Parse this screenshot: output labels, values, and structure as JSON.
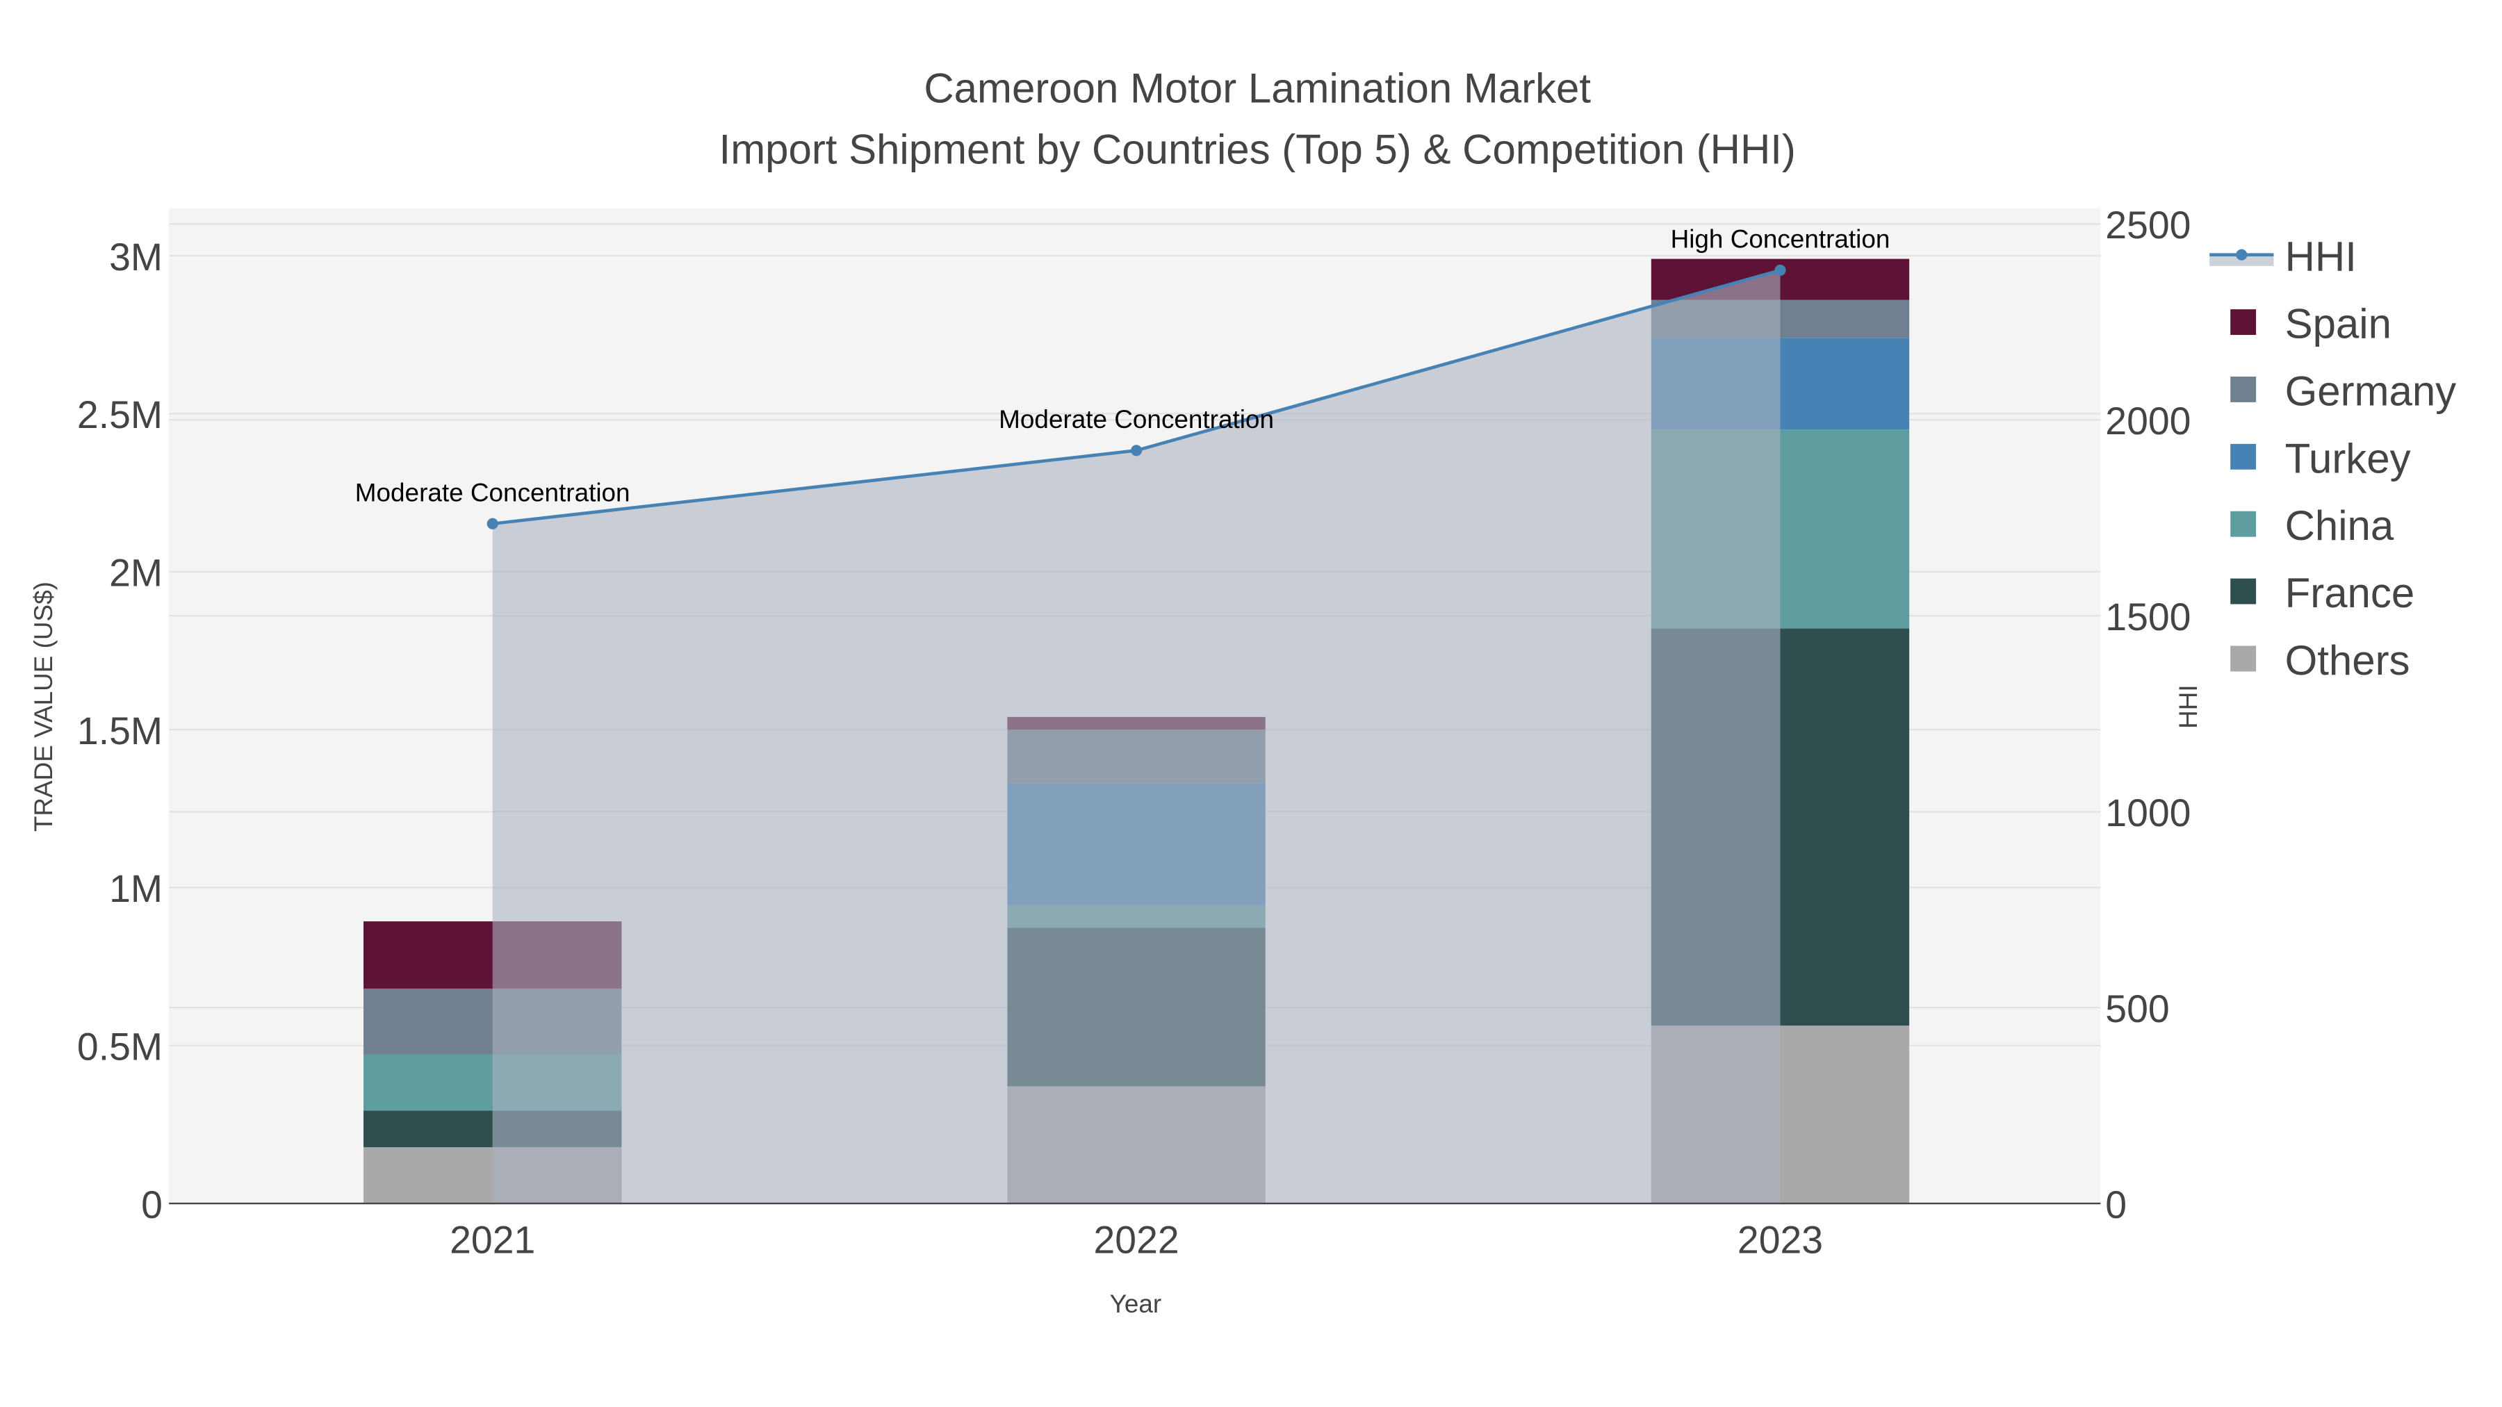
{
  "chart_data": {
    "type": "bar",
    "title": "Cameroon Motor Lamination Market",
    "subtitle": "Import Shipment by Countries (Top 5) & Competition (HHI)",
    "xlabel": "Year",
    "ylabel": "TRADE VALUE (US$)",
    "y2label": "HHI",
    "categories": [
      "2021",
      "2022",
      "2023"
    ],
    "ylim": [
      0,
      3150000
    ],
    "y2lim": [
      0,
      2540
    ],
    "yticks": [
      {
        "v": 0,
        "label": "0"
      },
      {
        "v": 500000,
        "label": "0.5M"
      },
      {
        "v": 1000000,
        "label": "1M"
      },
      {
        "v": 1500000,
        "label": "1.5M"
      },
      {
        "v": 2000000,
        "label": "2M"
      },
      {
        "v": 2500000,
        "label": "2.5M"
      },
      {
        "v": 3000000,
        "label": "3M"
      }
    ],
    "y2ticks": [
      {
        "v": 0,
        "label": "0"
      },
      {
        "v": 500,
        "label": "500"
      },
      {
        "v": 1000,
        "label": "1000"
      },
      {
        "v": 1500,
        "label": "1500"
      },
      {
        "v": 2000,
        "label": "2000"
      },
      {
        "v": 2500,
        "label": "2500"
      }
    ],
    "stacked": true,
    "series": [
      {
        "name": "Others",
        "color": "#a9a9a9",
        "values": [
          178000,
          371000,
          563000
        ]
      },
      {
        "name": "France",
        "color": "#2f4f4f",
        "values": [
          116000,
          502000,
          1257000
        ]
      },
      {
        "name": "China",
        "color": "#5f9ea0",
        "values": [
          178000,
          71000,
          630000
        ]
      },
      {
        "name": "Turkey",
        "color": "#4682b4",
        "values": [
          0,
          386000,
          290000
        ]
      },
      {
        "name": "Germany",
        "color": "#708090",
        "values": [
          208000,
          170000,
          120000
        ]
      },
      {
        "name": "Spain",
        "color": "#5e1235",
        "values": [
          213000,
          40000,
          130000
        ]
      }
    ],
    "hhi": {
      "name": "HHI",
      "color": "#4682b4",
      "values": [
        1735,
        1922,
        2382
      ]
    },
    "annotations": [
      "Moderate Concentration",
      "Moderate Concentration",
      "High Concentration"
    ],
    "legend": [
      "HHI",
      "Spain",
      "Germany",
      "Turkey",
      "China",
      "France",
      "Others"
    ],
    "legend_position": "right",
    "grid": true
  }
}
